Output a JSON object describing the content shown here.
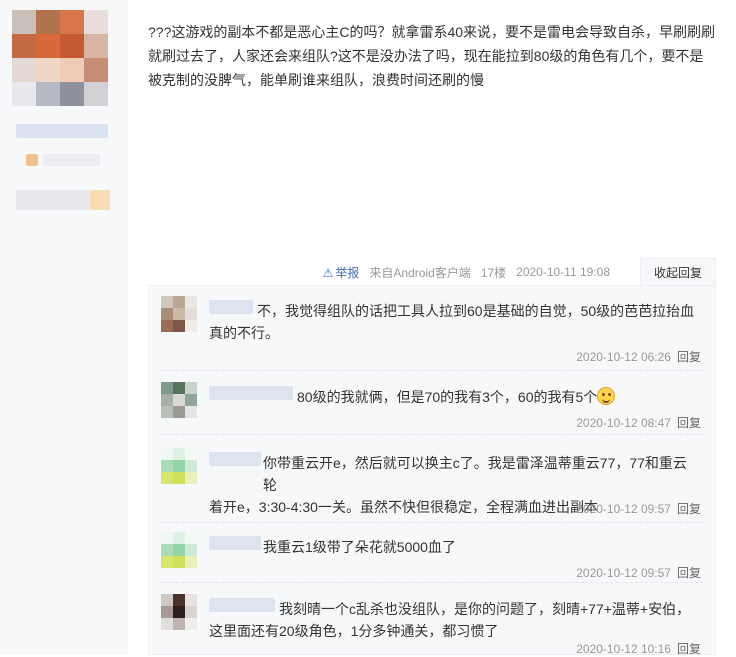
{
  "post": {
    "content": "???这游戏的副本不都是恶心主C的吗？就拿雷系40来说，要不是雷电会导致自杀，早刷刷刷就刷过去了，人家还会来组队?这不是没办法了吗，现在能拉到80级的角色有几个，要不是被克制的没脾气，能单刷谁来组队，浪费时间还刷的慢",
    "report_label": "举报",
    "source": "来自Android客户端",
    "floor": "17楼",
    "time": "2020-10-11 19:08",
    "collapse_label": "收起回复"
  },
  "replies": [
    {
      "text_line1": "不，我觉得组队的话把工具人拉到60是基础的自觉，50级的芭芭拉抬血",
      "text_line2": "真的不行。",
      "time": "2020-10-12 06:26",
      "reply_label": "回复"
    },
    {
      "text_line1": "80级的我就俩，但是70的我有3个，60的我有5个",
      "text_line2": "",
      "time": "2020-10-12 08:47",
      "reply_label": "回复"
    },
    {
      "text_line1": "你带重云开e，然后就可以换主c了。我是雷泽温蒂重云77，77和重云轮",
      "text_line2": "着开e，3:30-4:30一关。虽然不快但很稳定，全程满血进出副本",
      "time": "2020-10-12 09:57",
      "reply_label": "回复"
    },
    {
      "text_line1": "我重云1级带了朵花就5000血了",
      "text_line2": "",
      "time": "2020-10-12 09:57",
      "reply_label": "回复"
    },
    {
      "text_line1": "我刻晴一个c乱杀也没组队，是你的问题了，刻晴+77+温蒂+安伯，",
      "text_line2": "这里面还有20级角色，1分多钟通关，都习惯了",
      "time": "2020-10-12 10:16",
      "reply_label": "回复"
    }
  ],
  "icons": {
    "report": "warning-icon",
    "emoji": "smiley-emoji-icon"
  },
  "colors": {
    "link": "#3d6db8",
    "meta": "#999999",
    "reply_bg": "#f7f8fa"
  }
}
